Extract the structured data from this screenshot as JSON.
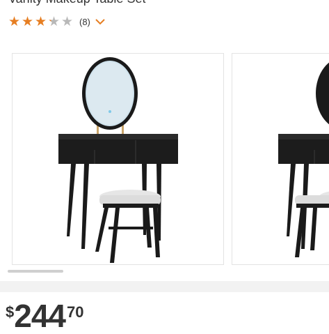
{
  "product": {
    "title": "Vanity Makeup Table Set",
    "rating": 3.3,
    "review_count": "(8)",
    "price": {
      "currency": "$",
      "whole": "244",
      "cents": "70"
    }
  },
  "gallery": {
    "images": [
      {
        "icon": "vanity-table-with-mirror-and-stool-image"
      },
      {
        "icon": "vanity-table-with-mirror-and-stool-image"
      }
    ],
    "scroll_position": 0.0
  },
  "colors": {
    "star_filled": "#e67e22",
    "star_empty": "#b8b8b8",
    "chevron": "#e67e22",
    "text": "#333333",
    "divider": "#f2f2f2"
  }
}
